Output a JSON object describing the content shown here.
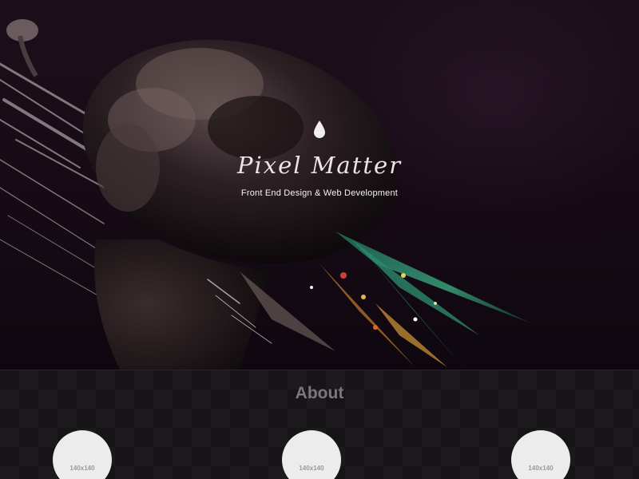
{
  "hero": {
    "title": "Pixel Matter",
    "tagline": "Front End Design & Web Development",
    "icon": "droplet-icon"
  },
  "about": {
    "heading": "About",
    "thumbnails": [
      {
        "label": "140x140"
      },
      {
        "label": "140x140"
      },
      {
        "label": "140x140"
      }
    ]
  },
  "colors": {
    "hero_background": "#160b15",
    "about_background": "#161416",
    "title_text": "#ece4ea",
    "heading_text": "#7b777b",
    "placeholder_circle": "#ececec"
  }
}
